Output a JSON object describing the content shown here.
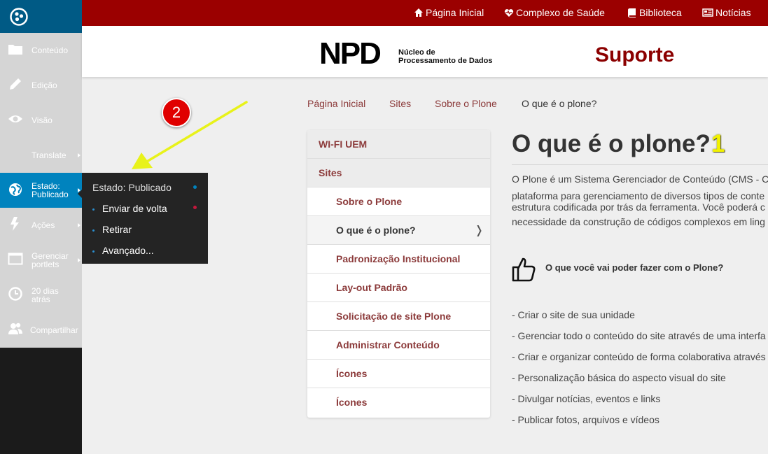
{
  "toolbar": {
    "items": [
      {
        "label": "Conteúdo",
        "icon": "folder-icon"
      },
      {
        "label": "Edição",
        "icon": "pencil-icon"
      },
      {
        "label": "Visão",
        "icon": "eye-icon"
      },
      {
        "label": "Translate",
        "icon": ""
      },
      {
        "label_line1": "Estado:",
        "label_line2": "Publicado",
        "icon": "globe-icon"
      },
      {
        "label": "Ações",
        "icon": "bolt-icon"
      },
      {
        "label_line1": "Gerenciar",
        "label_line2": "portlets",
        "icon": "layout-icon"
      },
      {
        "label_line1": "20 dias",
        "label_line2": "atrás",
        "icon": "clock-icon"
      },
      {
        "label": "Compartilhar",
        "icon": "users-icon"
      }
    ],
    "colors": {
      "logo_bg": "#005a85",
      "menu_bg": "#d5d5d5",
      "active_bg": "#0083be",
      "bottom_bg": "#1b1b1b"
    }
  },
  "state_menu": {
    "title": "Estado: Publicado",
    "items": [
      "Enviar de volta",
      "Retirar",
      "Avançado..."
    ],
    "dot_colors": {
      "published": "#0083be",
      "send_back": "#c4183c"
    }
  },
  "topbar": {
    "links": [
      {
        "label": "Página Inicial",
        "icon": "home-icon"
      },
      {
        "label": "Complexo de Saúde",
        "icon": "heart-pulse-icon"
      },
      {
        "label": "Biblioteca",
        "icon": "book-icon"
      },
      {
        "label": "Notícias",
        "icon": "newspaper-icon"
      }
    ],
    "color": "#9b0000"
  },
  "header": {
    "logo_text": "NPD",
    "logo_sub_line1": "Núcleo de",
    "logo_sub_line2": "Processamento de Dados",
    "section_title": "Suporte",
    "section_color": "#8b0000"
  },
  "breadcrumb": [
    "Página Inicial",
    "Sites",
    "Sobre o Plone",
    "O que é o plone?"
  ],
  "portlet": {
    "headers": [
      "WI-FI UEM",
      "Sites"
    ],
    "items": [
      "Sobre o Plone",
      "O que é o plone?",
      "Padronização Institucional",
      "Lay-out Padrão",
      "Solicitação de site Plone",
      "Administrar Conteúdo",
      "Ícones",
      "Ícones"
    ],
    "current_index": 1,
    "chevron": "❭",
    "link_color": "#8c3b3b"
  },
  "content": {
    "title": "O que é o plone?",
    "title_badge": "1",
    "paragraph_lines": [
      "O Plone é um Sistema Gerenciador de Conteúdo (CMS - C",
      "plataforma para gerenciamento de diversos tipos de conte",
      "estrutura codificada por trás da ferramenta. Você poderá c",
      "necessidade da construção de códigos complexos em ling"
    ],
    "subheading": "O que você vai poder fazer com o Plone?",
    "list": [
      "- Criar o site de sua unidade",
      "- Gerenciar todo o conteúdo do site através de uma interfa",
      "- Criar e organizar conteúdo de forma colaborativa através",
      "- Personalização básica do aspecto visual do site",
      "- Divulgar notícias, eventos e links",
      "- Publicar fotos, arquivos e vídeos"
    ]
  },
  "annotation": {
    "badge": "2",
    "arrow_color": "#e8f21a",
    "badge_color": "#e00000"
  }
}
